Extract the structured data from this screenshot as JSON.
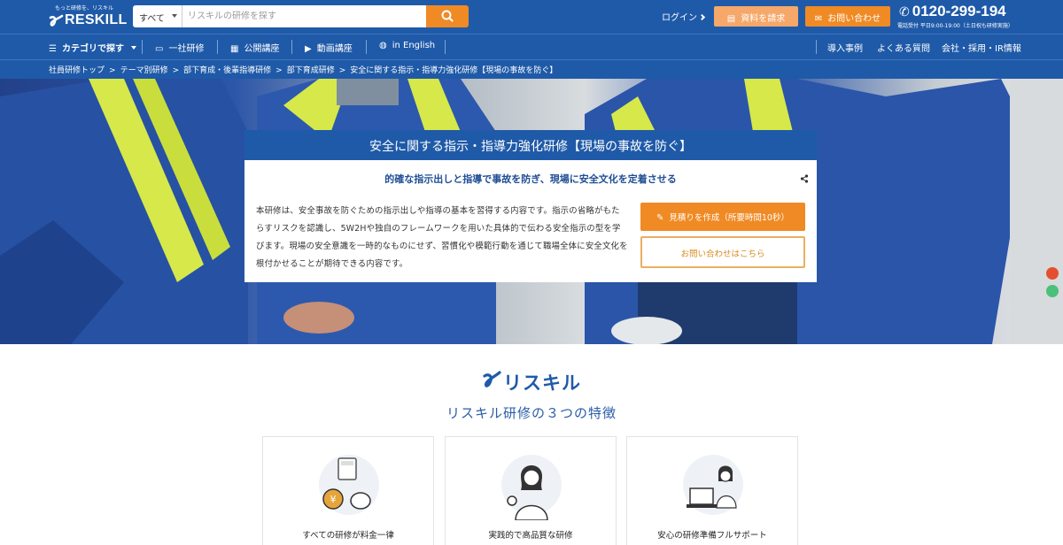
{
  "header": {
    "logo_tagline": "もっと研修を、リスキル",
    "logo_text": "RESKILL",
    "search": {
      "category": "すべて",
      "placeholder": "リスキルの研修を探す"
    },
    "login_label": "ログイン",
    "document_button": "資料を請求",
    "contact_button": "お問い合わせ",
    "phone": "0120-299-194",
    "phone_hours": "電話受付 平日9:00-19:00（土日祝も研修実施）"
  },
  "nav": {
    "category_label": "カテゴリで探す",
    "items": [
      {
        "label": "一社研修",
        "icon": "presentation-icon"
      },
      {
        "label": "公開講座",
        "icon": "calendar-icon"
      },
      {
        "label": "動画講座",
        "icon": "play-icon"
      },
      {
        "label": "in English",
        "icon": "globe-icon"
      }
    ],
    "right_items": [
      "導入事例",
      "よくある質問",
      "会社・採用・IR情報"
    ]
  },
  "breadcrumb": [
    "社員研修トップ",
    "テーマ別研修",
    "部下育成・後輩指導研修",
    "部下育成研修",
    "安全に関する指示・指導力強化研修【現場の事故を防ぐ】"
  ],
  "hero": {
    "title": "安全に関する指示・指導力強化研修【現場の事故を防ぐ】",
    "subtitle": "的確な指示出しと指導で事故を防ぎ、現場に安全文化を定着させる",
    "description": "本研修は、安全事故を防ぐための指示出しや指導の基本を習得する内容です。指示の省略がもたらすリスクを認識し、5W2Hや独自のフレームワークを用いた具体的で伝わる安全指示の型を学びます。現場の安全意識を一時的なものにせず、習慣化や模範行動を通じて職場全体に安全文化を根付かせることが期待できる内容です。",
    "quote_button": "見積りを作成（所要時間10秒）",
    "contact_button": "お問い合わせはこちら"
  },
  "features": {
    "brand": "リスキル",
    "title": "リスキル研修の３つの特徴",
    "cards": [
      {
        "label": "すべての研修が料金一律",
        "icon": "calculator-coin-icon"
      },
      {
        "label": "実践的で高品質な研修",
        "icon": "instructor-icon"
      },
      {
        "label": "安心の研修準備フルサポート",
        "icon": "laptop-support-icon"
      }
    ]
  },
  "colors": {
    "brand_blue": "#1f5aa8",
    "accent_orange": "#f08a24"
  }
}
